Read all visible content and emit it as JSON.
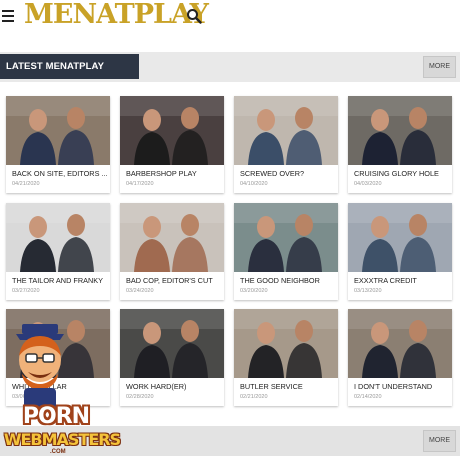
{
  "header": {
    "logo_text": "MENATPLAY",
    "logo_color": "#c9a227",
    "menu_icon": "hamburger-icon",
    "search_icon": "search-icon"
  },
  "section": {
    "title": "LATEST MENATPLAY MOVIES",
    "more_label": "MORE",
    "bottom_more_label": "MORE"
  },
  "movies": [
    {
      "title": "BACK ON SITE, EDITORS ...",
      "date": "04/21/2020",
      "bg": "#8a7a6a",
      "fig": "#2a3550"
    },
    {
      "title": "BARBERSHOP PLAY",
      "date": "04/17/2020",
      "bg": "#4a4040",
      "fig": "#1c1c1c"
    },
    {
      "title": "SCREWED OVER?",
      "date": "04/10/2020",
      "bg": "#bfb7ae",
      "fig": "#3b4e68"
    },
    {
      "title": "CRUISING GLORY HOLE",
      "date": "04/03/2020",
      "bg": "#6e6a64",
      "fig": "#1d2233"
    },
    {
      "title": "THE TAILOR AND FRANKY",
      "date": "03/27/2020",
      "bg": "#d9d9d9",
      "fig": "#262a33"
    },
    {
      "title": "BAD COP, EDITOR'S CUT",
      "date": "03/24/2020",
      "bg": "#c9c2bb",
      "fig": "#a06a50"
    },
    {
      "title": "THE GOOD NEIGHBOR",
      "date": "03/20/2020",
      "bg": "#7b8d8c",
      "fig": "#2a2f3e"
    },
    {
      "title": "EXXXTRA CREDIT",
      "date": "03/13/2020",
      "bg": "#9fa7b2",
      "fig": "#3e5168"
    },
    {
      "title": "WHITE COLLAR",
      "date": "03/06/2020",
      "bg": "#7d6d60",
      "fig": "#2a2a33"
    },
    {
      "title": "WORK HARD(ER)",
      "date": "02/28/2020",
      "bg": "#4a4a48",
      "fig": "#1f1f24"
    },
    {
      "title": "BUTLER SERVICE",
      "date": "02/21/2020",
      "bg": "#a6998a",
      "fig": "#232326"
    },
    {
      "title": "I DON'T UNDERSTAND",
      "date": "02/14/2020",
      "bg": "#8b7f72",
      "fig": "#202430"
    }
  ],
  "watermark": {
    "word1": "PORN",
    "word2": "WEBMASTERS",
    "suffix": ".COM"
  }
}
